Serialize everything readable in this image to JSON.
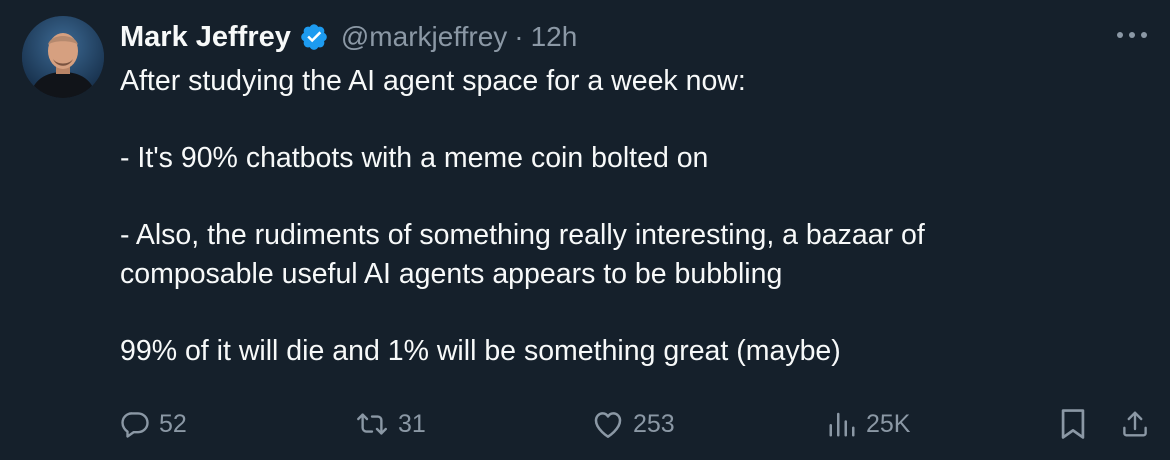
{
  "tweet": {
    "author": {
      "display_name": "Mark Jeffrey",
      "handle": "@markjeffrey",
      "verified": true
    },
    "separator": "·",
    "time": "12h",
    "text_lines": [
      "After studying the AI agent space for a week now:",
      "",
      "- It's 90% chatbots with a meme coin bolted on",
      "",
      "- Also, the rudiments of something really interesting, a bazaar of",
      "composable useful AI agents appears to be bubbling",
      "",
      "99% of it will die and 1% will be something great (maybe)"
    ],
    "stats": {
      "replies": "52",
      "reposts": "31",
      "likes": "253",
      "views": "25K"
    },
    "icons": {
      "more": "more-horizontal-icon",
      "reply": "reply-icon",
      "repost": "repost-icon",
      "like": "heart-icon",
      "views": "views-icon",
      "bookmark": "bookmark-icon",
      "share": "share-icon",
      "verified": "verified-badge-icon"
    }
  },
  "colors": {
    "background": "#15202b",
    "text": "#f7f9f9",
    "muted": "#8b98a5",
    "verified": "#1d9bf0"
  }
}
